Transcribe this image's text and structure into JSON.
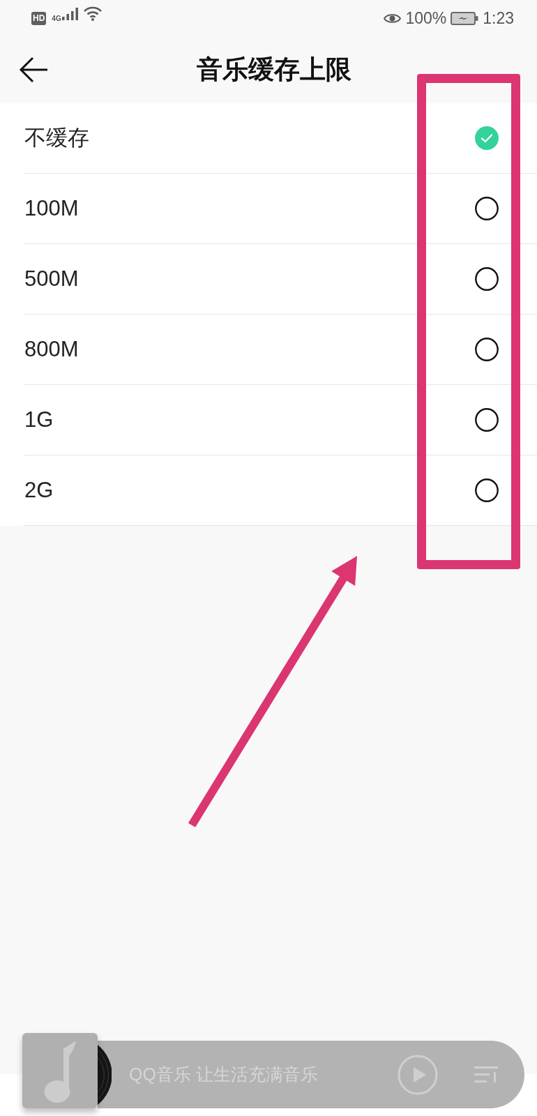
{
  "status_bar": {
    "hd_badge": "HD",
    "network_type": "4G",
    "battery_percent": "100%",
    "time": "1:23"
  },
  "header": {
    "title": "音乐缓存上限"
  },
  "options": [
    {
      "label": "不缓存",
      "selected": true
    },
    {
      "label": "100M",
      "selected": false
    },
    {
      "label": "500M",
      "selected": false
    },
    {
      "label": "800M",
      "selected": false
    },
    {
      "label": "1G",
      "selected": false
    },
    {
      "label": "2G",
      "selected": false
    }
  ],
  "mini_player": {
    "text": "QQ音乐 让生活充满音乐"
  }
}
